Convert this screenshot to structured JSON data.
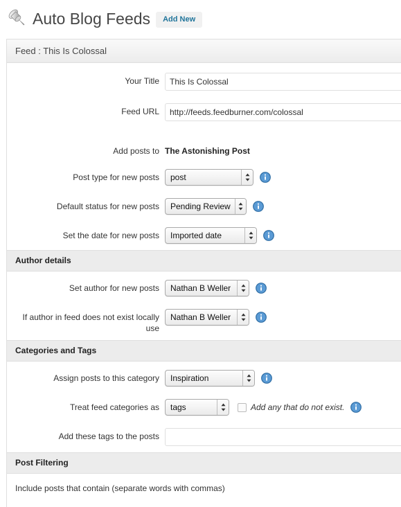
{
  "header": {
    "icon": "pushpin-icon",
    "title": "Auto Blog Feeds",
    "add_new_label": "Add New"
  },
  "panel": {
    "title": "Feed : This Is Colossal"
  },
  "fields": {
    "your_title": {
      "label": "Your Title",
      "value": "This Is Colossal"
    },
    "feed_url": {
      "label": "Feed URL",
      "value": "http://feeds.feedburner.com/colossal"
    },
    "add_posts_to": {
      "label": "Add posts to",
      "value": "The Astonishing Post"
    },
    "post_type": {
      "label": "Post type for new posts",
      "value": "post",
      "info": "info-icon"
    },
    "default_status": {
      "label": "Default status for new posts",
      "value": "Pending Review",
      "info": "info-icon"
    },
    "post_date": {
      "label": "Set the date for new posts",
      "value": "Imported date",
      "info": "info-icon"
    }
  },
  "author_section": {
    "heading": "Author details",
    "set_author": {
      "label": "Set author for new posts",
      "value": "Nathan B Weller",
      "info": "info-icon"
    },
    "fallback_author": {
      "label": "If author in feed does not exist locally use",
      "value": "Nathan B Weller",
      "info": "info-icon"
    }
  },
  "categories_section": {
    "heading": "Categories and Tags",
    "assign_category": {
      "label": "Assign posts to this category",
      "value": "Inspiration",
      "info": "info-icon"
    },
    "treat_feed_categories": {
      "label": "Treat feed categories as",
      "value": "tags",
      "checkbox_label": "Add any that do not exist.",
      "checkbox_checked": false,
      "info": "info-icon"
    },
    "add_tags": {
      "label": "Add these tags to the posts",
      "value": "",
      "placeholder": ""
    }
  },
  "filtering_section": {
    "heading": "Post Filtering",
    "include_text": "Include posts that contain (separate words with commas)"
  },
  "colors": {
    "link_blue": "#21759b",
    "info_blue": "#3c7fb1",
    "panel_border": "#dfdfdf",
    "section_bg": "#ececec",
    "title_gray": "#464646"
  }
}
